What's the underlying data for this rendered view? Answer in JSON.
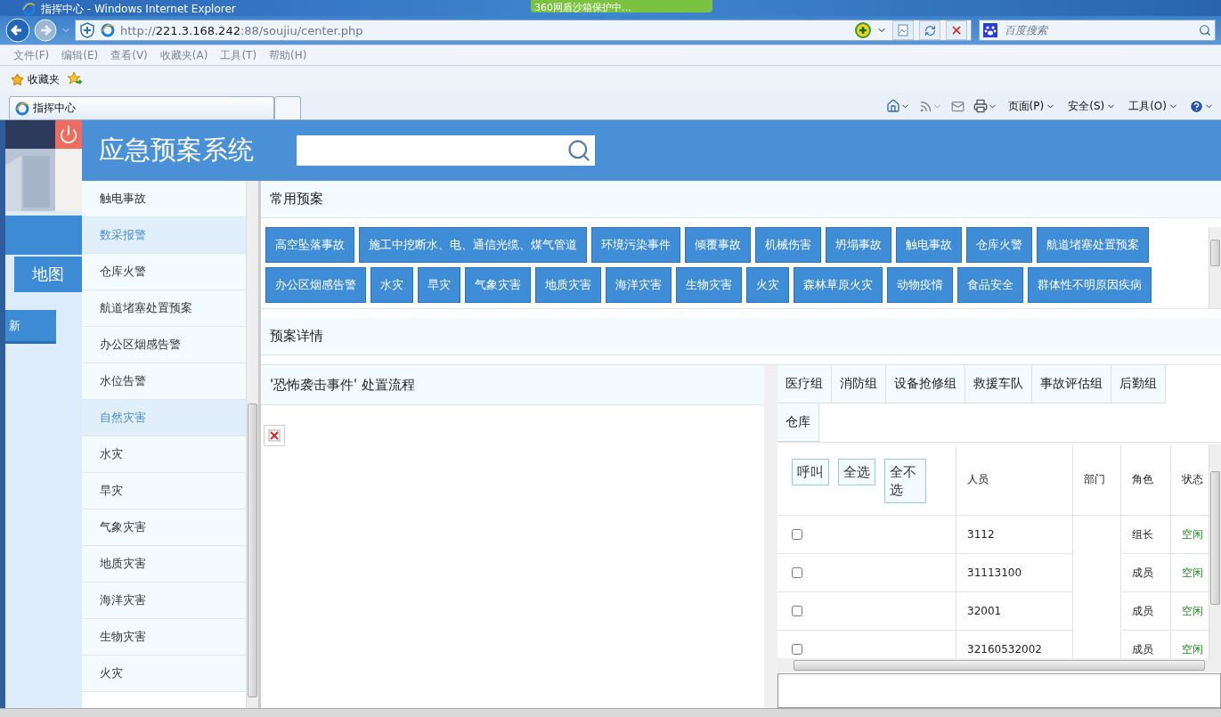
{
  "browser": {
    "title": "指挥中心 - Windows Internet Explorer",
    "notification": "360网盾沙箱保护中…",
    "url": {
      "scheme": "http://",
      "domain": "221.3.168.242",
      "path": ":88/soujiu/center.php"
    },
    "search": {
      "placeholder": "百度搜索"
    },
    "menu": [
      "文件(F)",
      "编辑(E)",
      "查看(V)",
      "收藏夹(A)",
      "工具(T)",
      "帮助(H)"
    ],
    "favorites": "收藏夹",
    "tabs": [
      {
        "label": "指挥中心",
        "selected": true
      }
    ],
    "commands": [
      "页面(P)",
      "安全(S)",
      "工具(O)"
    ]
  },
  "app": {
    "title": "应急预案系统"
  },
  "left_nav": {
    "map_button": "地图",
    "refresh_button": "新"
  },
  "sidebar": {
    "items": [
      {
        "label": "触电事故",
        "kind": "item"
      },
      {
        "label": "数采报警",
        "kind": "category"
      },
      {
        "label": "仓库火警",
        "kind": "item"
      },
      {
        "label": "航道堵塞处置预案",
        "kind": "item"
      },
      {
        "label": "办公区烟感告警",
        "kind": "item"
      },
      {
        "label": "水位告警",
        "kind": "item"
      },
      {
        "label": "自然灾害",
        "kind": "category"
      },
      {
        "label": "水灾",
        "kind": "item"
      },
      {
        "label": "旱灾",
        "kind": "item"
      },
      {
        "label": "气象灾害",
        "kind": "item"
      },
      {
        "label": "地质灾害",
        "kind": "item"
      },
      {
        "label": "海洋灾害",
        "kind": "item"
      },
      {
        "label": "生物灾害",
        "kind": "item"
      },
      {
        "label": "火灾",
        "kind": "item"
      }
    ]
  },
  "common_plans": {
    "title": "常用预案",
    "buttons": [
      "高空坠落事故",
      "施工中挖断水、电、通信光缆、煤气管道",
      "环境污染事件",
      "倾覆事故",
      "机械伤害",
      "坍塌事故",
      "触电事故",
      "仓库火警",
      "航道堵塞处置预案",
      "办公区烟感告警",
      "水灾",
      "旱灾",
      "气象灾害",
      "地质灾害",
      "海洋灾害",
      "生物灾害",
      "火灾",
      "森林草原火灾",
      "动物疫情",
      "食品安全",
      "群体性不明原因疾病"
    ]
  },
  "details": {
    "title": "预案详情",
    "flow_title": "'恐怖袭击事件' 处置流程"
  },
  "groups": {
    "tabs": [
      "医疗组",
      "消防组",
      "设备抢修组",
      "救援车队",
      "事故评估组",
      "后勤组",
      "仓库"
    ]
  },
  "table": {
    "actions": [
      "呼叫",
      "全选",
      "全不选"
    ],
    "columns": [
      "人员",
      "部门",
      "角色",
      "状态"
    ],
    "rows": [
      {
        "checked": false,
        "person": "3112",
        "role": "组长",
        "status": "空闲"
      },
      {
        "checked": false,
        "person": "31113100",
        "role": "成员",
        "status": "空闲"
      },
      {
        "checked": false,
        "person": "32001",
        "role": "成员",
        "status": "空闲"
      },
      {
        "checked": false,
        "person": "32160532002",
        "role": "成员",
        "status": "空闲"
      }
    ]
  }
}
